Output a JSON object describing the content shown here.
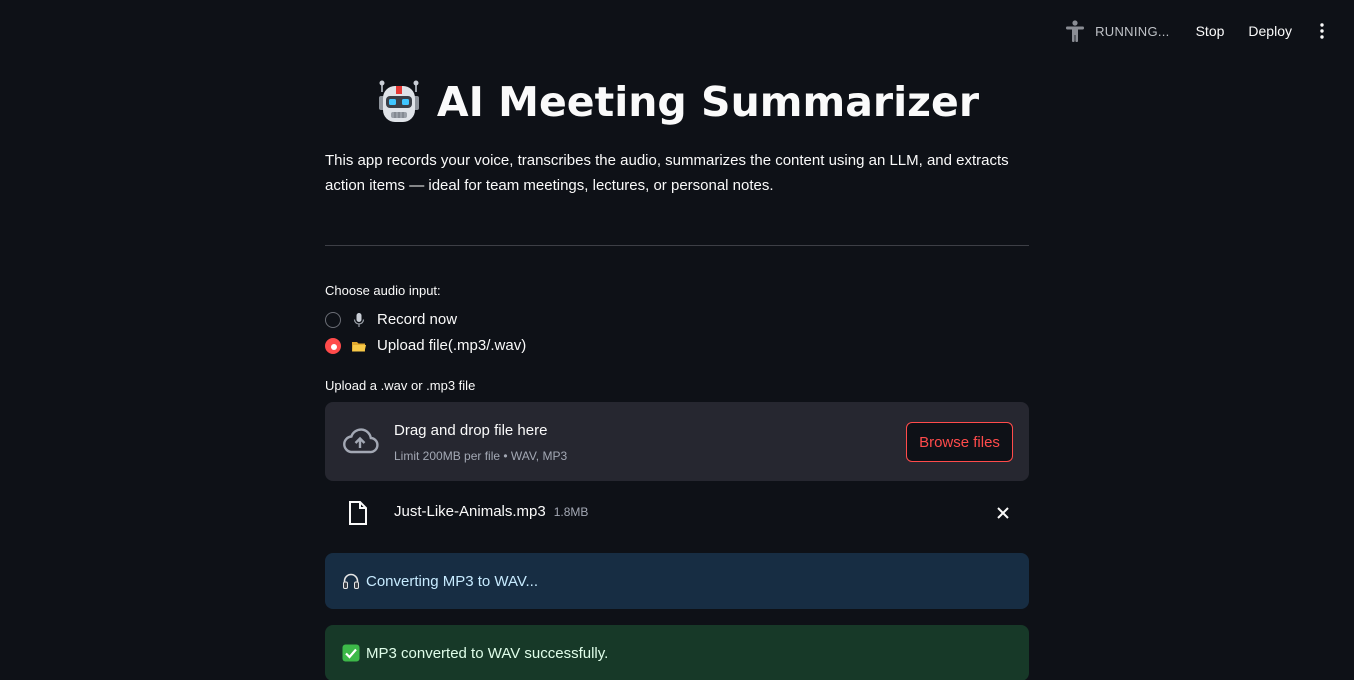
{
  "toolbar": {
    "status_icon": "running-person-icon",
    "status_text": "RUNNING...",
    "stop_label": "Stop",
    "deploy_label": "Deploy",
    "menu_icon": "vertical-dots-icon"
  },
  "header": {
    "icon": "robot-emoji-icon",
    "title": "AI Meeting Summarizer",
    "intro": "This app records your voice, transcribes the audio, summarizes the content using an LLM, and extracts action items — ideal for team meetings, lectures, or personal notes."
  },
  "audio_input": {
    "label": "Choose audio input:",
    "options": [
      {
        "icon": "microphone-icon",
        "label": "Record now",
        "selected": false
      },
      {
        "icon": "folder-icon",
        "label": "Upload file(.mp3/.wav)",
        "selected": true
      }
    ]
  },
  "uploader": {
    "label": "Upload a .wav or .mp3 file",
    "drop_title": "Drag and drop file here",
    "drop_subtitle": "Limit 200MB per file • WAV, MP3",
    "browse_label": "Browse files",
    "accent": "#ff4b4b"
  },
  "uploaded_file": {
    "name": "Just-Like-Animals.mp3",
    "size": "1.8MB"
  },
  "messages": [
    {
      "type": "info",
      "icon": "headphones-icon",
      "text": "Converting MP3 to WAV..."
    },
    {
      "type": "success",
      "icon": "check-mark-icon",
      "text": "MP3 converted to WAV successfully."
    }
  ],
  "colors": {
    "background": "#0e1117",
    "info_bg": "#172d43",
    "success_bg": "#173928"
  }
}
